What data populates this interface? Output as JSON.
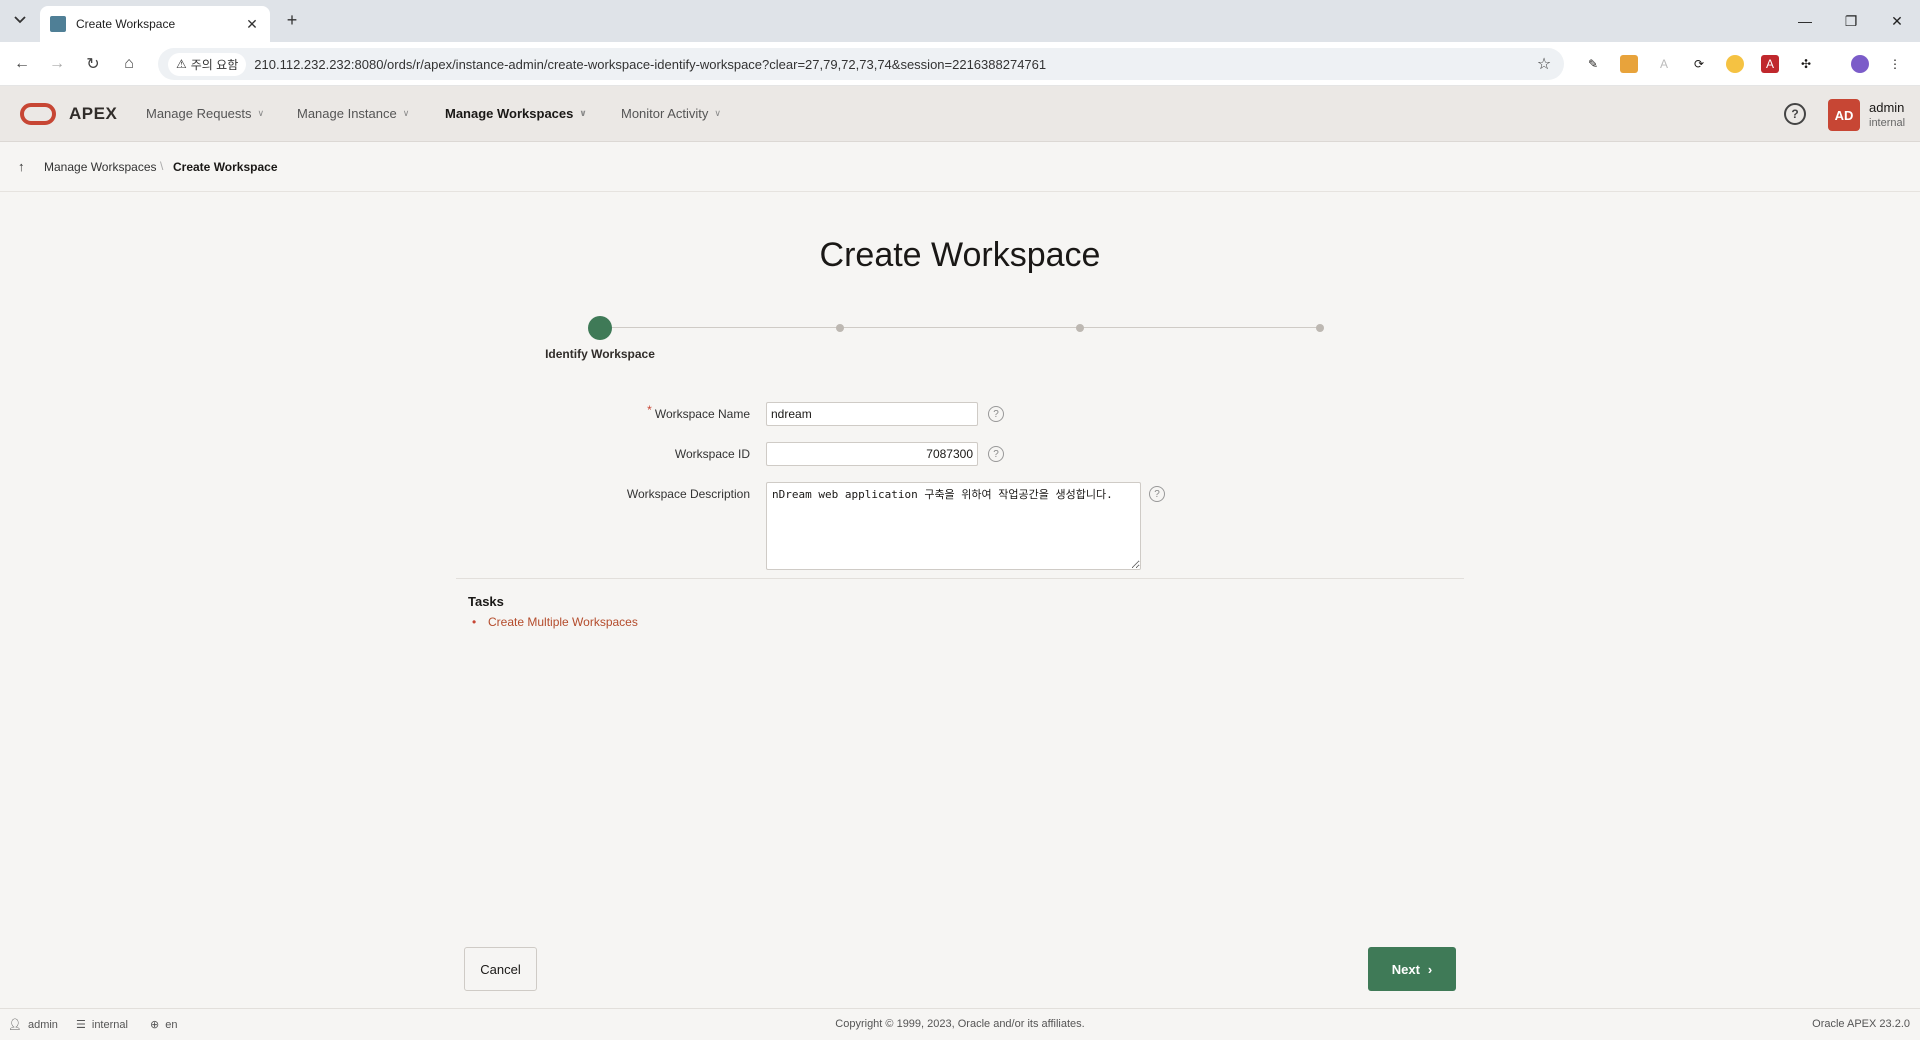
{
  "browser": {
    "tab_title": "Create Workspace",
    "security_warning": "주의 요함",
    "url": "210.112.232.232:8080/ords/r/apex/instance-admin/create-workspace-identify-workspace?clear=27,79,72,73,74&session=2216388274761"
  },
  "header": {
    "app_name": "APEX",
    "menu": [
      {
        "label": "Manage Requests"
      },
      {
        "label": "Manage Instance"
      },
      {
        "label": "Manage Workspaces"
      },
      {
        "label": "Monitor Activity"
      }
    ],
    "user": {
      "initials": "AD",
      "name": "admin",
      "workspace": "internal"
    }
  },
  "breadcrumb": {
    "parent": "Manage Workspaces",
    "current": "Create Workspace"
  },
  "page": {
    "title": "Create Workspace"
  },
  "wizard": {
    "active_step_label": "Identify Workspace",
    "total_steps": 4,
    "current_step": 1
  },
  "form": {
    "workspace_name": {
      "label": "Workspace Name",
      "value": "ndream",
      "required": true
    },
    "workspace_id": {
      "label": "Workspace ID",
      "value": "7087300"
    },
    "workspace_description": {
      "label": "Workspace Description",
      "value": "nDream web application 구축을 위하여 작업공간을 생성합니다."
    }
  },
  "tasks": {
    "title": "Tasks",
    "items": [
      "Create Multiple Workspaces"
    ]
  },
  "buttons": {
    "cancel": "Cancel",
    "next": "Next"
  },
  "footer": {
    "user": "admin",
    "workspace": "internal",
    "language": "en",
    "copyright": "Copyright © 1999, 2023, Oracle and/or its affiliates.",
    "version": "Oracle APEX 23.2.0"
  },
  "colors": {
    "accent": "#3f7a57",
    "brand": "#c74634"
  }
}
